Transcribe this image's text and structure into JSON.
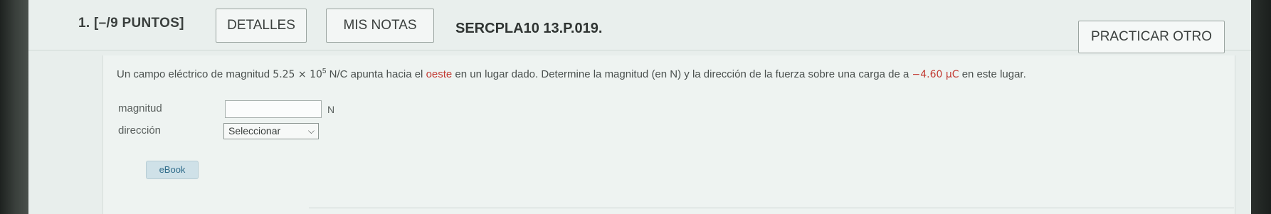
{
  "question": {
    "number": "1. [–/9 PUNTOS]",
    "detalles_label": "DETALLES",
    "notas_label": "MIS NOTAS",
    "id": "SERCPLA10 13.P.019.",
    "practicar_label": "PRACTICAR OTRO",
    "text_1": "Un campo eléctrico de magnitud ",
    "field_value": "5.25 × 10",
    "field_exp": "5",
    "field_units": " N/C",
    "text_2": " apunta hacia el ",
    "direction_word": "oeste",
    "text_3": " en un lugar dado. Determine la magnitud (en N) y la dirección de la fuerza sobre una carga de a ",
    "charge_value": "−4.60 μC",
    "text_4": "  en este lugar."
  },
  "form": {
    "magnitude_label": "magnitud",
    "magnitude_value": "",
    "magnitude_unit": "N",
    "direction_label": "dirección",
    "direction_selected": "Seleccionar"
  },
  "ebook_label": "eBook",
  "colors": {
    "accent_red": "#c23a32",
    "ebook_bg": "#cfe1e8",
    "ebook_text": "#2f6c8a"
  }
}
